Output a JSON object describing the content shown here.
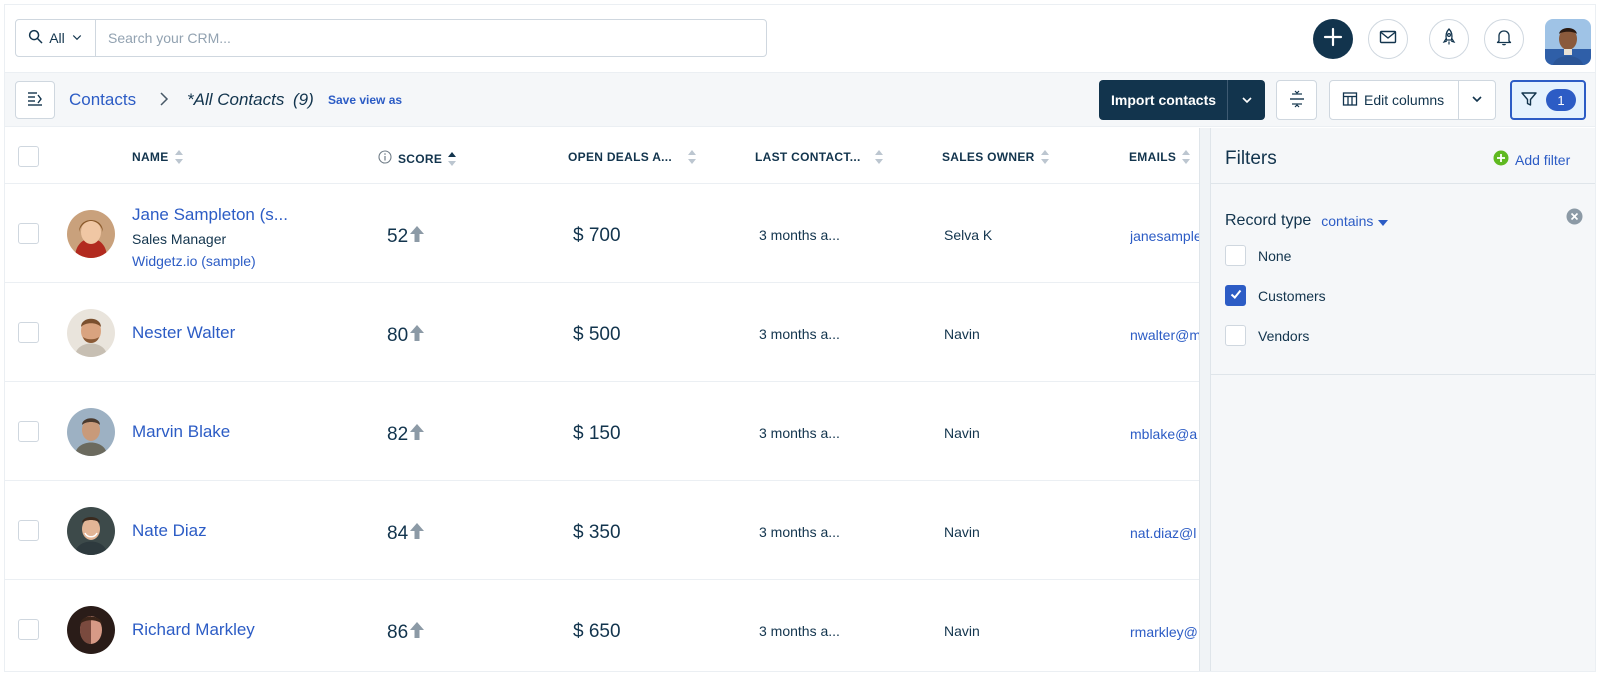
{
  "search": {
    "scope": "All",
    "placeholder": "Search your CRM..."
  },
  "breadcrumb": {
    "root": "Contacts",
    "view": "*All Contacts",
    "count": "(9)",
    "save_view": "Save view as"
  },
  "toolbar": {
    "import_label": "Import contacts",
    "edit_columns_label": "Edit columns",
    "filter_count": "1"
  },
  "table": {
    "columns": {
      "name": "NAME",
      "score": "SCORE",
      "open_deals": "OPEN DEALS A...",
      "last_contact": "LAST CONTACT...",
      "sales_owner": "SALES OWNER",
      "emails": "EMAILS"
    },
    "rows": [
      {
        "name": "Jane Sampleton (s...",
        "title": "Sales Manager",
        "company": "Widgetz.io (sample)",
        "score": "52",
        "deal": "$ 700",
        "last_contact": "3 months a...",
        "owner": "Selva K",
        "email": "janesampleton@"
      },
      {
        "name": "Nester Walter",
        "score": "80",
        "deal": "$ 500",
        "last_contact": "3 months a...",
        "owner": "Navin",
        "email": "nwalter@m"
      },
      {
        "name": "Marvin Blake",
        "score": "82",
        "deal": "$ 150",
        "last_contact": "3 months a...",
        "owner": "Navin",
        "email": "mblake@a"
      },
      {
        "name": "Nate Diaz",
        "score": "84",
        "deal": "$ 350",
        "last_contact": "3 months a...",
        "owner": "Navin",
        "email": "nat.diaz@l"
      },
      {
        "name": "Richard Markley",
        "score": "86",
        "deal": "$ 650",
        "last_contact": "3 months a...",
        "owner": "Navin",
        "email": "rmarkley@"
      }
    ]
  },
  "filters": {
    "title": "Filters",
    "add_filter": "Add filter",
    "record_type": {
      "label": "Record type",
      "operator": "contains",
      "options": [
        {
          "label": "None",
          "checked": false
        },
        {
          "label": "Customers",
          "checked": true
        },
        {
          "label": "Vendors",
          "checked": false
        }
      ]
    }
  },
  "colors": {
    "primary": "#12344d",
    "link": "#2c5cc5",
    "success": "#5fb920"
  }
}
